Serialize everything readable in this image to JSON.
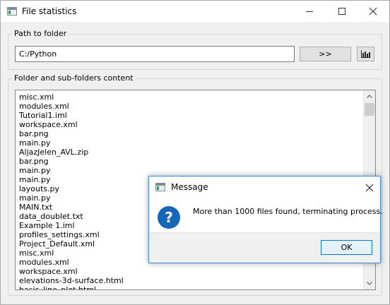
{
  "window": {
    "title": "File statistics",
    "icon": "app-window-icon",
    "controls": {
      "minimize": "minimize-icon",
      "maximize": "maximize-icon",
      "close": "close-icon"
    }
  },
  "path_group": {
    "label": "Path to folder",
    "path_value": "C:/Python",
    "go_button_label": ">>",
    "stats_button_icon": "bar-chart-icon"
  },
  "content_group": {
    "label": "Folder and sub-folders content",
    "files": [
      "misc.xml",
      "modules.xml",
      "Tutorial1.iml",
      "workspace.xml",
      "bar.png",
      "main.py",
      "AljazJelen_AVL.zip",
      "bar.png",
      "main.py",
      "main.py",
      "layouts.py",
      "main.py",
      "MAIN.txt",
      "data_doublet.txt",
      "Example 1.iml",
      "profiles_settings.xml",
      "Project_Default.xml",
      "misc.xml",
      "modules.xml",
      "workspace.xml",
      "elevations-3d-surface.html",
      "basic_line_plot.html"
    ]
  },
  "dialog": {
    "title": "Message",
    "icon": "question-icon",
    "icon_glyph": "?",
    "message": "More than 1000 files found, terminating process.",
    "ok_label": "OK"
  },
  "colors": {
    "window_bg": "#f0f0f0",
    "accent": "#0078d7",
    "question_icon": "#1667b8"
  }
}
